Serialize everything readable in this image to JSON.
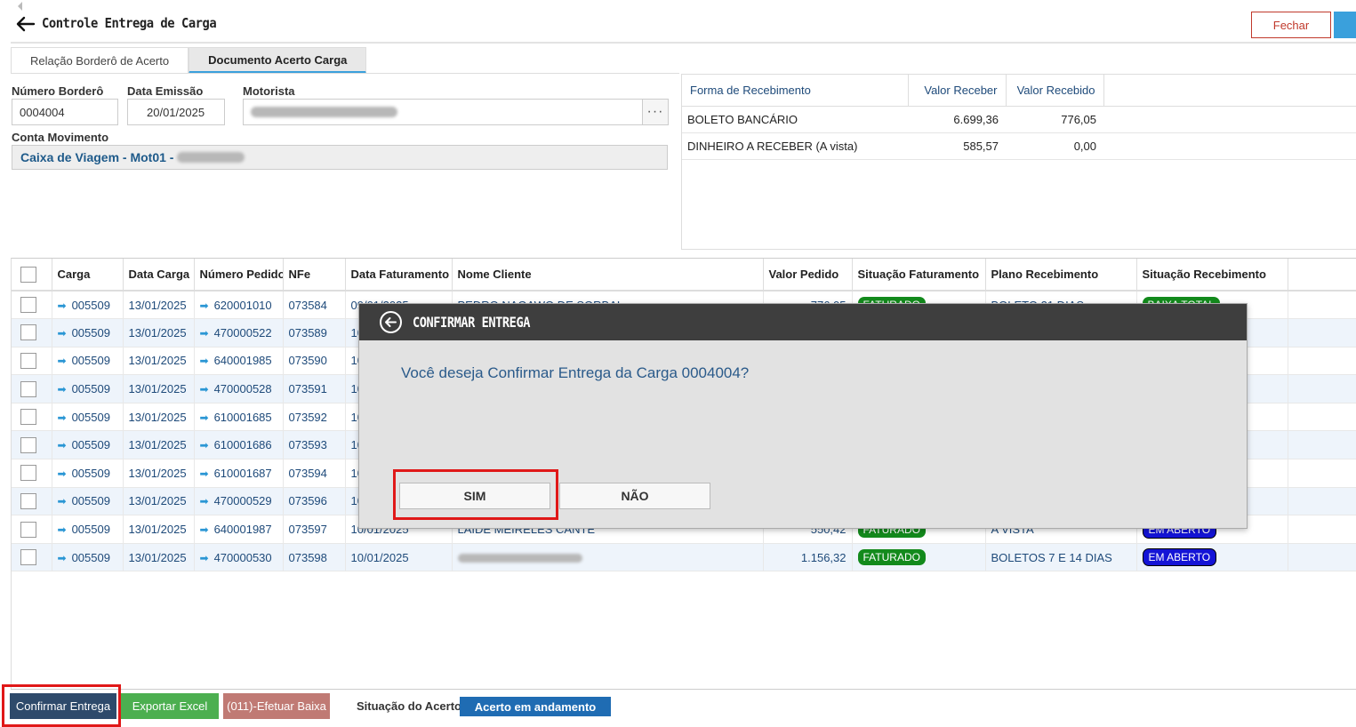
{
  "header": {
    "title": "Controle Entrega de Carga",
    "close_label": "Fechar"
  },
  "tabs": [
    {
      "label": "Relação Borderô de Acerto"
    },
    {
      "label": "Documento Acerto Carga"
    }
  ],
  "form": {
    "bordero_label": "Número Borderô",
    "bordero_value": "0004004",
    "emissao_label": "Data Emissão",
    "emissao_value": "20/01/2025",
    "motorista_label": "Motorista",
    "motorista_visible": "Luis Augusto...",
    "conta_label": "Conta Movimento",
    "conta_value": "Caixa de Viagem - Mot01 -",
    "lookup_label": "···"
  },
  "recebimento": {
    "headers": [
      "Forma de Recebimento",
      "Valor Receber",
      "Valor Recebido"
    ],
    "rows": [
      [
        "BOLETO BANCÁRIO",
        "6.699,36",
        "776,05"
      ],
      [
        "DINHEIRO A RECEBER (A vista)",
        "585,57",
        "0,00"
      ]
    ]
  },
  "grid": {
    "headers": [
      "Carga",
      "Data Carga",
      "Número Pedido",
      "NFe",
      "Data Faturamento",
      "Nome Cliente",
      "Valor Pedido",
      "Situação Faturamento",
      "Plano Recebimento",
      "Situação Recebimento"
    ],
    "rows": [
      {
        "carga": "005509",
        "data": "13/01/2025",
        "pedido": "620001010",
        "nfe": "073584"
      },
      {
        "carga": "005509",
        "data": "13/01/2025",
        "pedido": "470000522",
        "nfe": "073589"
      },
      {
        "carga": "005509",
        "data": "13/01/2025",
        "pedido": "640001985",
        "nfe": "073590"
      },
      {
        "carga": "005509",
        "data": "13/01/2025",
        "pedido": "470000528",
        "nfe": "073591"
      },
      {
        "carga": "005509",
        "data": "13/01/2025",
        "pedido": "610001685",
        "nfe": "073592"
      },
      {
        "carga": "005509",
        "data": "13/01/2025",
        "pedido": "610001686",
        "nfe": "073593"
      },
      {
        "carga": "005509",
        "data": "13/01/2025",
        "pedido": "610001687",
        "nfe": "073594"
      },
      {
        "carga": "005509",
        "data": "13/01/2025",
        "pedido": "470000529",
        "nfe": "073596"
      },
      {
        "carga": "005509",
        "data": "13/01/2025",
        "pedido": "640001987",
        "nfe": "073597"
      },
      {
        "carga": "005509",
        "data": "13/01/2025",
        "pedido": "470000530",
        "nfe": "073598",
        "faturamento": "10/01/2025",
        "valor": "1.156,32",
        "sit_fat": "FATURADO",
        "plano": "BOLETOS 7 E 14 DIAS",
        "sit_rec": "EM ABERTO"
      }
    ],
    "partial_text": {
      "row0_fat": "09/01/2025",
      "row0_cliente": "PEDRO NAGAWO DE SORBAL",
      "row0_valor": "776,05",
      "row0_sitfat": "FATURADO",
      "row0_plano": "BOLETO 21 DIAS",
      "row0_sitrec": "BAIXA TOTAL",
      "row8_fat": "10/01/2025",
      "row8_cliente": "LAIDE MEIRELES CANTE",
      "row8_valor": "550,42",
      "row8_sitfat": "FATURADO",
      "row8_plano": "A VISTA",
      "row8_sitrec": "EM ABERTO",
      "col_nfe_prefix": "10"
    }
  },
  "footer": {
    "confirmar": "Confirmar Entrega",
    "exportar": "Exportar Excel",
    "efetuar": "(011)-Efetuar Baixa",
    "situacao_label": "Situação do Acerto",
    "situacao_value": "Acerto em andamento"
  },
  "modal": {
    "title": "CONFIRMAR ENTREGA",
    "message": "Você deseja Confirmar Entrega da Carga 0004004?",
    "yes": "SIM",
    "no": "NÃO"
  },
  "colors": {
    "accent": "#3aa0dc",
    "danger": "#c0392b",
    "confirm_btn": "#2e4a6b",
    "export_btn": "#4caf50",
    "baixa_btn": "#c07a74",
    "badge_green": "#138a1c",
    "badge_blue": "#1414d6"
  }
}
